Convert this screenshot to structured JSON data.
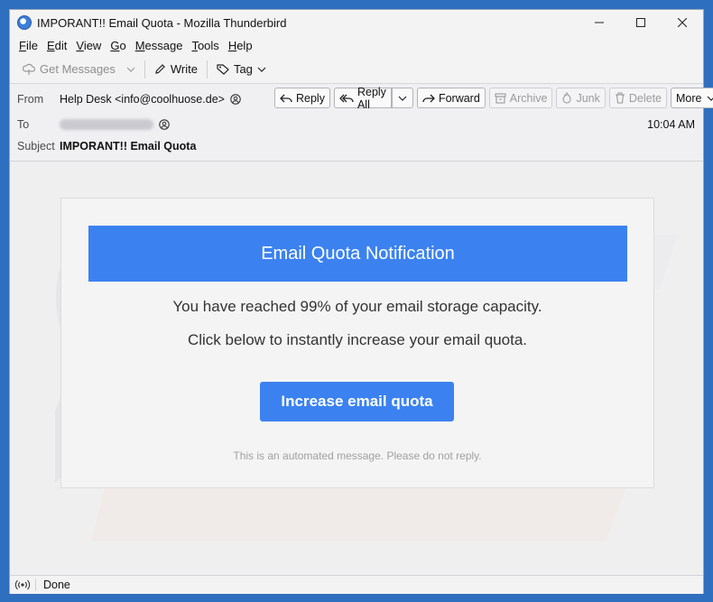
{
  "window": {
    "title": "IMPORANT!! Email Quota - Mozilla Thunderbird"
  },
  "menu": [
    {
      "label": "File",
      "ul": "F",
      "rest": "ile"
    },
    {
      "label": "Edit",
      "ul": "E",
      "rest": "dit"
    },
    {
      "label": "View",
      "ul": "V",
      "rest": "iew"
    },
    {
      "label": "Go",
      "ul": "G",
      "rest": "o"
    },
    {
      "label": "Message",
      "ul": "M",
      "rest": "essage"
    },
    {
      "label": "Tools",
      "ul": "T",
      "rest": "ools"
    },
    {
      "label": "Help",
      "ul": "H",
      "rest": "elp"
    }
  ],
  "toolbar": {
    "get_messages": "Get Messages",
    "write": "Write",
    "tag": "Tag"
  },
  "header": {
    "from_label": "From",
    "from_value": "Help Desk <info@coolhuose.de>",
    "to_label": "To",
    "subject_label": "Subject",
    "subject_value": "IMPORANT!! Email Quota",
    "time": "10:04 AM",
    "buttons": {
      "reply": "Reply",
      "reply_all": "Reply All",
      "forward": "Forward",
      "archive": "Archive",
      "junk": "Junk",
      "delete": "Delete",
      "more": "More"
    }
  },
  "email": {
    "banner": "Email Quota Notification",
    "line1": "You have reached 99% of your email storage capacity.",
    "line2": "Click below to instantly increase your email quota.",
    "cta": "Increase email quota",
    "footer": "This is an automated message. Please do not reply."
  },
  "status": {
    "text": "Done"
  },
  "colors": {
    "accent": "#3b82f0"
  }
}
